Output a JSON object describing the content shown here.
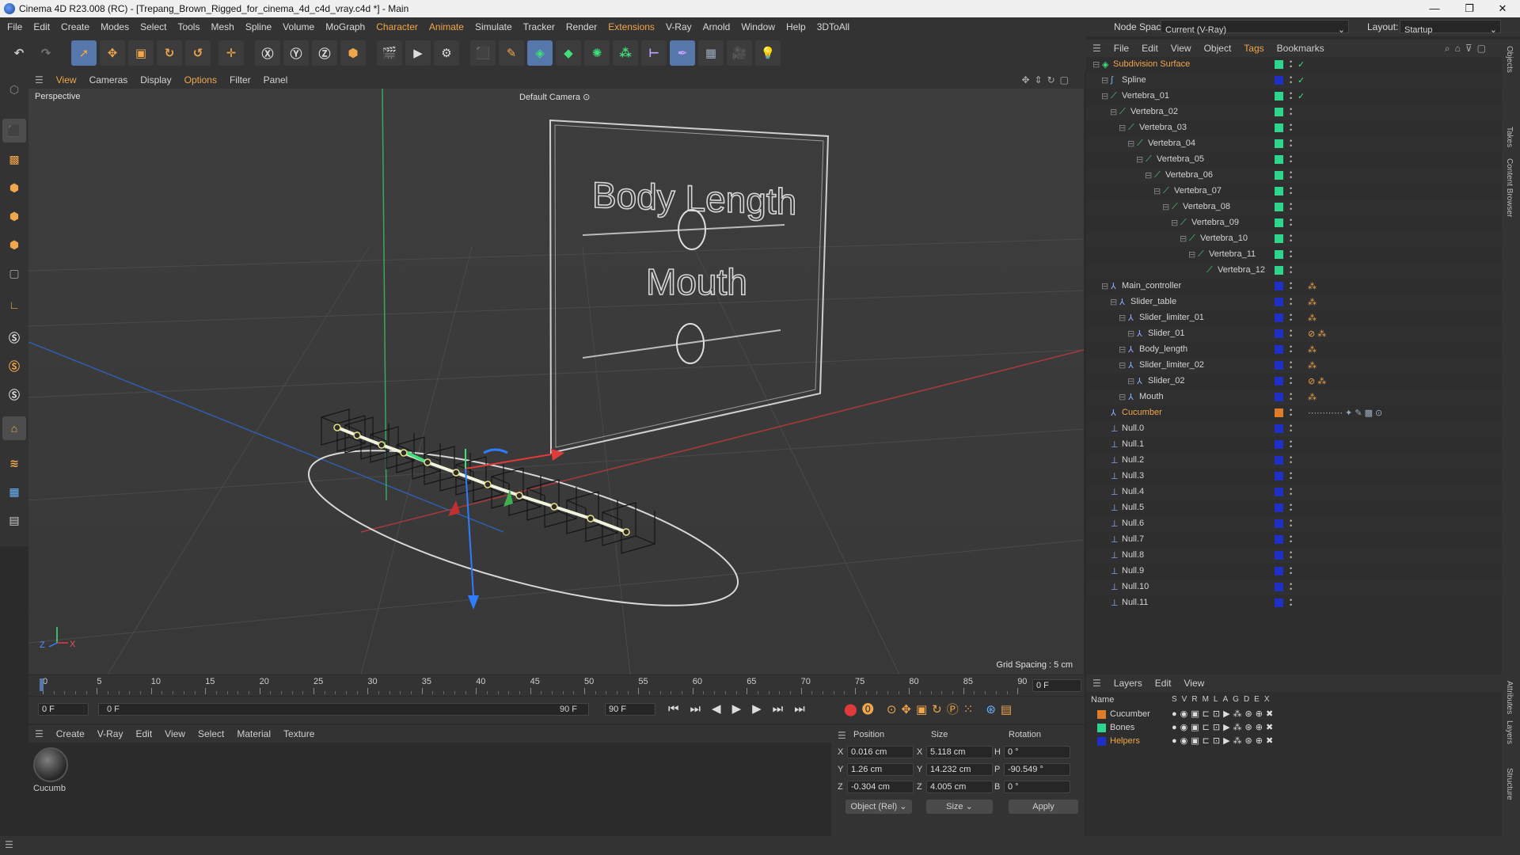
{
  "window": {
    "title": "Cinema 4D R23.008 (RC) - [Trepang_Brown_Rigged_for_cinema_4d_c4d_vray.c4d *] - Main",
    "controls": [
      "—",
      "❐",
      "✕"
    ]
  },
  "menubar": {
    "items": [
      "File",
      "Edit",
      "Create",
      "Modes",
      "Select",
      "Tools",
      "Mesh",
      "Spline",
      "Volume",
      "MoGraph",
      "Character",
      "Animate",
      "Simulate",
      "Tracker",
      "Render",
      "Extensions",
      "V-Ray",
      "Arnold",
      "Window",
      "Help",
      "3DToAll"
    ],
    "node_space_label": "Node Space:",
    "node_space_value": "Current (V-Ray)",
    "layout_label": "Layout:",
    "layout_value": "Startup"
  },
  "viewport": {
    "menu": [
      "View",
      "Cameras",
      "Display",
      "Options",
      "Filter",
      "Panel"
    ],
    "projection": "Perspective",
    "camera": "Default Camera",
    "grid_spacing": "Grid Spacing : 5 cm",
    "board_label_1": "Body Length",
    "board_label_2": "Mouth"
  },
  "timeline": {
    "ticks": [
      "0",
      "5",
      "10",
      "15",
      "20",
      "25",
      "30",
      "35",
      "40",
      "45",
      "50",
      "55",
      "60",
      "65",
      "70",
      "75",
      "80",
      "85",
      "90"
    ],
    "current_frame_right": "0 F",
    "start_frame": "0 F",
    "min_frame": "0 F",
    "max_frame": "90 F",
    "end_frame": "90 F"
  },
  "material_manager": {
    "menu": [
      "Create",
      "V-Ray",
      "Edit",
      "View",
      "Select",
      "Material",
      "Texture"
    ],
    "materials": [
      {
        "name": "Cucumb"
      }
    ]
  },
  "coordinates": {
    "headers": [
      "Position",
      "Size",
      "Rotation"
    ],
    "position": [
      {
        "axis": "X",
        "value": "0.016 cm"
      },
      {
        "axis": "Y",
        "value": "1.26 cm"
      },
      {
        "axis": "Z",
        "value": "-0.304 cm"
      }
    ],
    "size": [
      {
        "axis": "X",
        "value": "5.118 cm"
      },
      {
        "axis": "Y",
        "value": "14.232 cm"
      },
      {
        "axis": "Z",
        "value": "4.005 cm"
      }
    ],
    "rotation": [
      {
        "axis": "H",
        "value": "0 °"
      },
      {
        "axis": "P",
        "value": "-90.549 °"
      },
      {
        "axis": "B",
        "value": "0 °"
      }
    ],
    "mode": "Object (Rel)",
    "size_mode": "Size",
    "apply": "Apply"
  },
  "object_manager": {
    "menu": [
      "File",
      "Edit",
      "View",
      "Object",
      "Tags",
      "Bookmarks"
    ],
    "objects": [
      {
        "name": "Subdivision Surface",
        "depth": 0,
        "color": "#2cd68f",
        "highlight": true,
        "type": "subdiv"
      },
      {
        "name": "Spline",
        "depth": 1,
        "color": "#1f2fc8",
        "type": "spline"
      },
      {
        "name": "Vertebra_01",
        "depth": 1,
        "color": "#2cd68f",
        "type": "bone"
      },
      {
        "name": "Vertebra_02",
        "depth": 2,
        "color": "#2cd68f",
        "type": "bone"
      },
      {
        "name": "Vertebra_03",
        "depth": 3,
        "color": "#2cd68f",
        "type": "bone"
      },
      {
        "name": "Vertebra_04",
        "depth": 4,
        "color": "#2cd68f",
        "type": "bone"
      },
      {
        "name": "Vertebra_05",
        "depth": 5,
        "color": "#2cd68f",
        "type": "bone"
      },
      {
        "name": "Vertebra_06",
        "depth": 6,
        "color": "#2cd68f",
        "type": "bone"
      },
      {
        "name": "Vertebra_07",
        "depth": 7,
        "color": "#2cd68f",
        "type": "bone"
      },
      {
        "name": "Vertebra_08",
        "depth": 8,
        "color": "#2cd68f",
        "type": "bone"
      },
      {
        "name": "Vertebra_09",
        "depth": 9,
        "color": "#2cd68f",
        "type": "bone"
      },
      {
        "name": "Vertebra_10",
        "depth": 10,
        "color": "#2cd68f",
        "type": "bone"
      },
      {
        "name": "Vertebra_11",
        "depth": 11,
        "color": "#2cd68f",
        "type": "bone"
      },
      {
        "name": "Vertebra_12",
        "depth": 12,
        "color": "#2cd68f",
        "type": "bone"
      },
      {
        "name": "Main_controller",
        "depth": 1,
        "color": "#1f2fc8",
        "type": "null"
      },
      {
        "name": "Slider_table",
        "depth": 2,
        "color": "#1f2fc8",
        "type": "null"
      },
      {
        "name": "Slider_limiter_01",
        "depth": 3,
        "color": "#1f2fc8",
        "type": "null"
      },
      {
        "name": "Slider_01",
        "depth": 4,
        "color": "#1f2fc8",
        "type": "null"
      },
      {
        "name": "Body_length",
        "depth": 3,
        "color": "#1f2fc8",
        "type": "null"
      },
      {
        "name": "Slider_limiter_02",
        "depth": 3,
        "color": "#1f2fc8",
        "type": "null"
      },
      {
        "name": "Slider_02",
        "depth": 4,
        "color": "#1f2fc8",
        "type": "null"
      },
      {
        "name": "Mouth",
        "depth": 3,
        "color": "#1f2fc8",
        "type": "null"
      },
      {
        "name": "Cucumber",
        "depth": 1,
        "color": "#e07b2a",
        "highlight": true,
        "type": "null"
      },
      {
        "name": "Null.0",
        "depth": 1,
        "color": "#1f2fc8",
        "type": "joint"
      },
      {
        "name": "Null.1",
        "depth": 1,
        "color": "#1f2fc8",
        "type": "joint"
      },
      {
        "name": "Null.2",
        "depth": 1,
        "color": "#1f2fc8",
        "type": "joint"
      },
      {
        "name": "Null.3",
        "depth": 1,
        "color": "#1f2fc8",
        "type": "joint"
      },
      {
        "name": "Null.4",
        "depth": 1,
        "color": "#1f2fc8",
        "type": "joint"
      },
      {
        "name": "Null.5",
        "depth": 1,
        "color": "#1f2fc8",
        "type": "joint"
      },
      {
        "name": "Null.6",
        "depth": 1,
        "color": "#1f2fc8",
        "type": "joint"
      },
      {
        "name": "Null.7",
        "depth": 1,
        "color": "#1f2fc8",
        "type": "joint"
      },
      {
        "name": "Null.8",
        "depth": 1,
        "color": "#1f2fc8",
        "type": "joint"
      },
      {
        "name": "Null.9",
        "depth": 1,
        "color": "#1f2fc8",
        "type": "joint"
      },
      {
        "name": "Null.10",
        "depth": 1,
        "color": "#1f2fc8",
        "type": "joint"
      },
      {
        "name": "Null.11",
        "depth": 1,
        "color": "#1f2fc8",
        "type": "joint"
      }
    ]
  },
  "layer_manager": {
    "menu": [
      "Layers",
      "Edit",
      "View"
    ],
    "name_header": "Name",
    "flag_headers": [
      "S",
      "V",
      "R",
      "M",
      "L",
      "A",
      "G",
      "D",
      "E",
      "X"
    ],
    "layers": [
      {
        "name": "Cucumber",
        "color": "#e07b2a"
      },
      {
        "name": "Bones",
        "color": "#2cd68f"
      },
      {
        "name": "Helpers",
        "color": "#1f2fc8",
        "highlight": true
      }
    ]
  },
  "side_tabs": [
    "Objects",
    "Takes",
    "Content Browser",
    "Attributes",
    "Layers",
    "Structure"
  ],
  "colors": {
    "accent": "#f0a64a",
    "selection": "#5577aa",
    "panel": "#333333"
  }
}
